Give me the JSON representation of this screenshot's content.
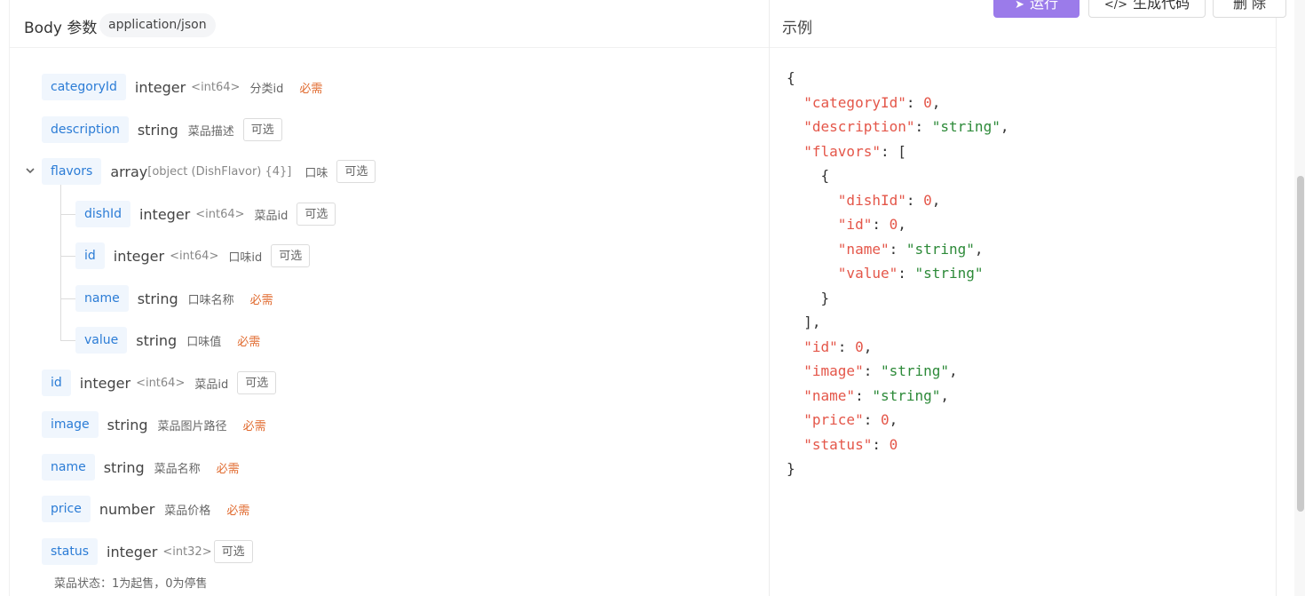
{
  "header": {
    "title": "Body 参数",
    "content_type": "application/json"
  },
  "example": {
    "title": "示例"
  },
  "toolbar": {
    "run_label": "运行",
    "gen_label": "生成代码",
    "delete_label": "删 除"
  },
  "fields": [
    {
      "name": "categoryId",
      "type": "integer",
      "format": "<int64>",
      "desc": "分类id",
      "tag": "必需"
    },
    {
      "name": "description",
      "type": "string",
      "format": "",
      "desc": "菜品描述",
      "tag": "可选"
    },
    {
      "name": "flavors",
      "type": "array",
      "format": "[object (DishFlavor) {4}]",
      "desc": "口味",
      "tag": "可选"
    },
    {
      "name": "dishId",
      "type": "integer",
      "format": "<int64>",
      "desc": "菜品id",
      "tag": "可选"
    },
    {
      "name": "id",
      "type": "integer",
      "format": "<int64>",
      "desc": "口味id",
      "tag": "可选"
    },
    {
      "name": "name",
      "type": "string",
      "format": "",
      "desc": "口味名称",
      "tag": "必需"
    },
    {
      "name": "value",
      "type": "string",
      "format": "",
      "desc": "口味值",
      "tag": "必需"
    },
    {
      "name": "id",
      "type": "integer",
      "format": "<int64>",
      "desc": "菜品id",
      "tag": "可选"
    },
    {
      "name": "image",
      "type": "string",
      "format": "",
      "desc": "菜品图片路径",
      "tag": "必需"
    },
    {
      "name": "name",
      "type": "string",
      "format": "",
      "desc": "菜品名称",
      "tag": "必需"
    },
    {
      "name": "price",
      "type": "number",
      "format": "",
      "desc": "菜品价格",
      "tag": "必需"
    },
    {
      "name": "status",
      "type": "integer",
      "format": "<int32>",
      "desc": "",
      "tag": "可选"
    }
  ],
  "status_note": "菜品状态：1为起售，0为停售",
  "json_example": {
    "open_brace": "{",
    "close_brace": "}",
    "categoryId_key": "\"categoryId\"",
    "categoryId_val": "0",
    "description_key": "\"description\"",
    "description_val": "\"string\"",
    "flavors_key": "\"flavors\"",
    "dishId_key": "\"dishId\"",
    "dishId_val": "0",
    "fid_key": "\"id\"",
    "fid_val": "0",
    "fname_key": "\"name\"",
    "fname_val": "\"string\"",
    "fvalue_key": "\"value\"",
    "fvalue_val": "\"string\"",
    "id_key": "\"id\"",
    "id_val": "0",
    "image_key": "\"image\"",
    "image_val": "\"string\"",
    "name_key": "\"name\"",
    "name_val": "\"string\"",
    "price_key": "\"price\"",
    "price_val": "0",
    "status_key": "\"status\"",
    "status_val": "0"
  }
}
